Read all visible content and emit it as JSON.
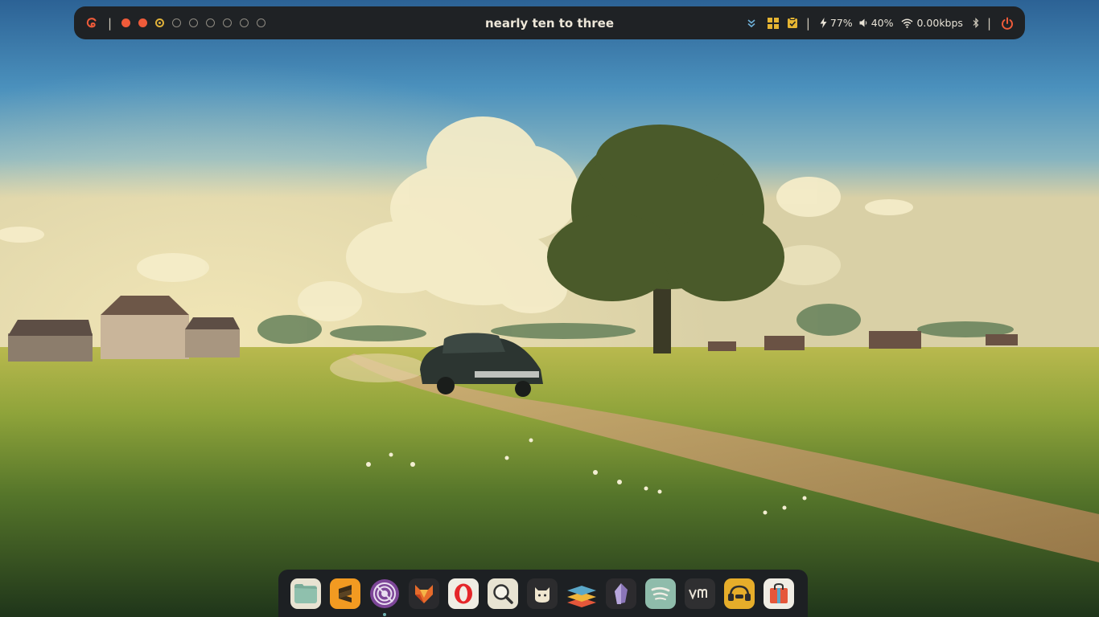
{
  "wallpaper": {
    "scene": "rural landscape with car, tree, farmhouse"
  },
  "topbar": {
    "launcher_icon": "debian-swirl-icon",
    "separator": "|",
    "workspaces": [
      {
        "state": "occupied"
      },
      {
        "state": "occupied"
      },
      {
        "state": "current"
      },
      {
        "state": "empty"
      },
      {
        "state": "empty"
      },
      {
        "state": "empty"
      },
      {
        "state": "empty"
      },
      {
        "state": "empty"
      },
      {
        "state": "empty"
      }
    ],
    "clock": "nearly ten to three",
    "tray": {
      "expand_icon": "double-chevron-down-icon",
      "layout_icon": "grid-layout-icon",
      "clipboard_icon": "clipboard-check-icon",
      "battery": "77%",
      "volume": "40%",
      "network": "0.00kbps",
      "bluetooth_icon": "bluetooth-icon",
      "power_icon": "power-icon"
    },
    "colors": {
      "accent": "#ef5b3a",
      "current": "#e0b13a",
      "bar": "#1f2225"
    }
  },
  "dock": {
    "apps": [
      {
        "name": "files",
        "icon": "folder-icon"
      },
      {
        "name": "sublime-text",
        "icon": "sublime-icon"
      },
      {
        "name": "tor-browser",
        "icon": "tor-icon",
        "running": true
      },
      {
        "name": "firefox",
        "icon": "firefox-icon"
      },
      {
        "name": "opera",
        "icon": "opera-icon"
      },
      {
        "name": "search",
        "icon": "magnifier-icon"
      },
      {
        "name": "github-desktop",
        "icon": "cat-icon"
      },
      {
        "name": "layers",
        "icon": "stack-icon"
      },
      {
        "name": "obsidian",
        "icon": "crystal-icon"
      },
      {
        "name": "spotify",
        "icon": "spotify-icon"
      },
      {
        "name": "vmware",
        "icon": "vm-icon"
      },
      {
        "name": "headset",
        "icon": "headset-icon"
      },
      {
        "name": "app-store",
        "icon": "bag-icon"
      }
    ]
  }
}
